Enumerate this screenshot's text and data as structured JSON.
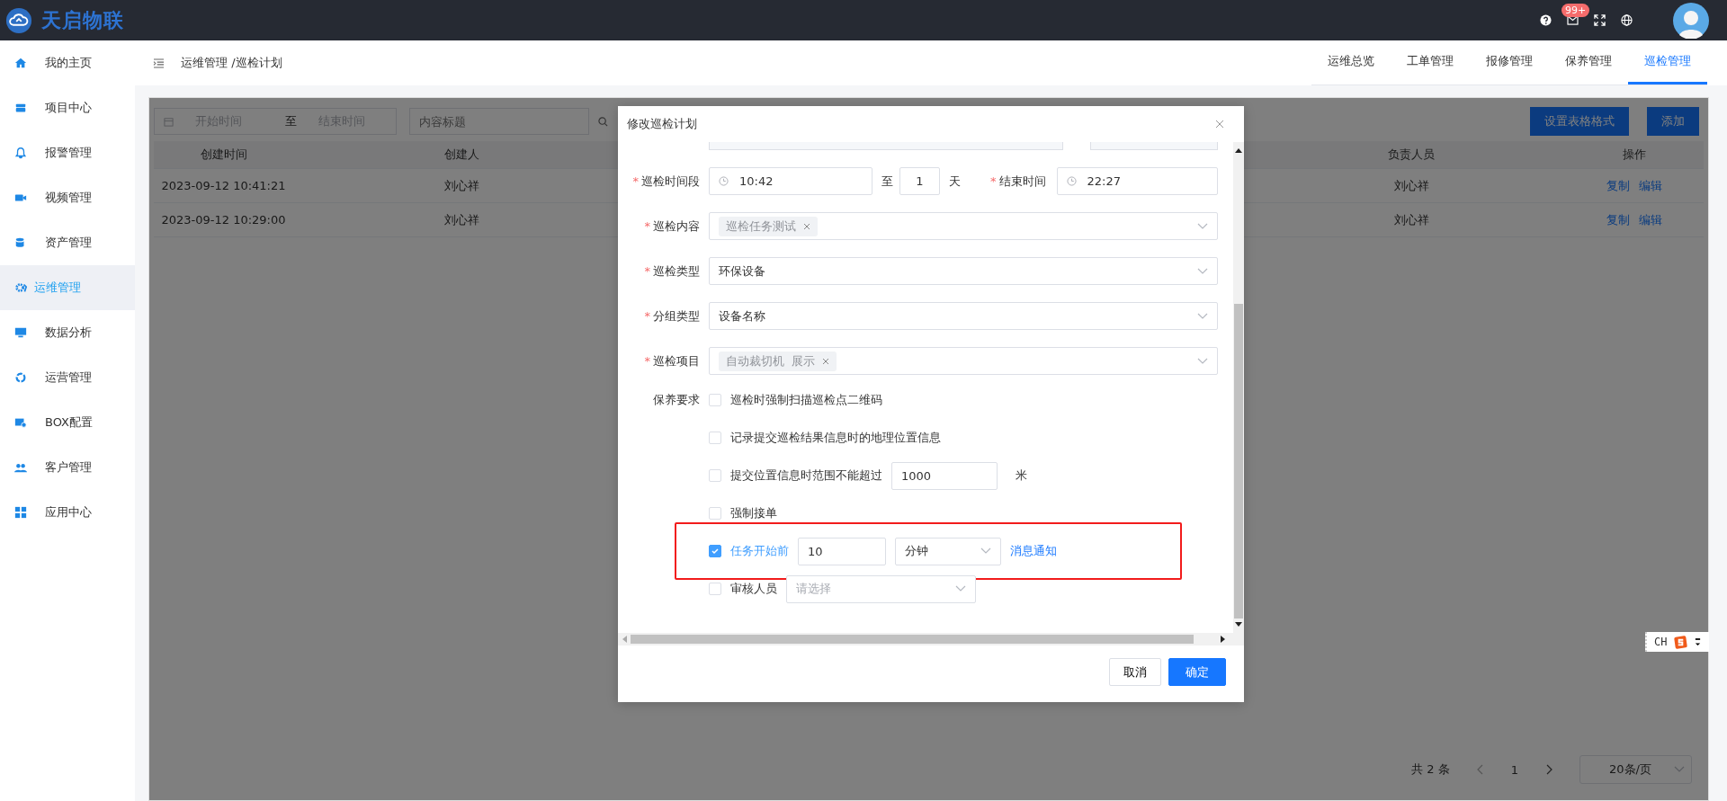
{
  "app": {
    "logo": "天启物联",
    "notification_count": "99+"
  },
  "sidebar": {
    "items": [
      {
        "label": "我的主页",
        "selected": false
      },
      {
        "label": "项目中心",
        "selected": false
      },
      {
        "label": "报警管理",
        "selected": false
      },
      {
        "label": "视频管理",
        "selected": false
      },
      {
        "label": "资产管理",
        "selected": false
      },
      {
        "label": "运维管理",
        "selected": true
      },
      {
        "label": "数据分析",
        "selected": false
      },
      {
        "label": "运营管理",
        "selected": false
      },
      {
        "label": "BOX配置",
        "selected": false
      },
      {
        "label": "客户管理",
        "selected": false
      },
      {
        "label": "应用中心",
        "selected": false
      }
    ]
  },
  "breadcrumb": "运维管理 /巡检计划",
  "tabs": [
    {
      "label": "运维总览",
      "selected": false
    },
    {
      "label": "工单管理",
      "selected": false
    },
    {
      "label": "报修管理",
      "selected": false
    },
    {
      "label": "保养管理",
      "selected": false
    },
    {
      "label": "巡检管理",
      "selected": true
    }
  ],
  "filters": {
    "start_placeholder": "开始时间",
    "range_separator": "至",
    "end_placeholder": "结束时间",
    "search_placeholder": "内容标题"
  },
  "toolbar_buttons": [
    "设置表格格式",
    "添加"
  ],
  "table": {
    "columns": [
      "创建时间",
      "创建人",
      "负责人员",
      "操作"
    ],
    "rows": [
      {
        "created": "2023-09-12 10:41:21",
        "creator": "刘心祥",
        "owner": "刘心祥",
        "actions": [
          "复制",
          "编辑"
        ]
      },
      {
        "created": "2023-09-12 10:29:00",
        "creator": "刘心祥",
        "owner": "刘心祥",
        "actions": [
          "复制",
          "编辑"
        ]
      }
    ]
  },
  "pagination": {
    "total": "共 2 条",
    "page": "1",
    "page_size": "20条/页"
  },
  "dialog": {
    "title": "修改巡检计划",
    "time_row": {
      "label": "巡检时间段",
      "required_mark": "*",
      "start": "10:42",
      "to": "至",
      "days": "1",
      "days_unit": "天",
      "end_label": "结束时间",
      "end_required_mark": "*",
      "end": "22:27"
    },
    "fields": [
      {
        "label": "巡检内容",
        "required_mark": "*",
        "kind": "tags",
        "tags": [
          "巡检任务测试"
        ]
      },
      {
        "label": "巡检类型",
        "required_mark": "*",
        "kind": "select",
        "value": "环保设备"
      },
      {
        "label": "分组类型",
        "required_mark": "*",
        "kind": "select",
        "value": "设备名称"
      },
      {
        "label": "巡检项目",
        "required_mark": "*",
        "kind": "tags",
        "tags": [
          "自动裁切机  展示"
        ]
      }
    ],
    "requirements": {
      "label": "保养要求",
      "options": [
        {
          "kind": "plain",
          "label": "巡检时强制扫描巡检点二维码",
          "checked": false
        },
        {
          "kind": "plain",
          "label": "记录提交巡检结果信息时的地理位置信息",
          "checked": false
        },
        {
          "kind": "distance",
          "label": "提交位置信息时范围不能超过",
          "value": "1000",
          "unit": "米",
          "checked": false
        },
        {
          "kind": "plain",
          "label": "强制接单",
          "checked": false
        },
        {
          "kind": "reminder",
          "label": "任务开始前",
          "value": "10",
          "unit": "分钟",
          "link": "消息通知",
          "checked": true,
          "highlighted": true
        },
        {
          "kind": "reviewer",
          "label": "审核人员",
          "placeholder": "请选择",
          "checked": false
        }
      ]
    },
    "buttons": [
      {
        "label": "取消",
        "primary": false
      },
      {
        "label": "确定",
        "primary": true
      }
    ]
  },
  "ime": {
    "label": "CH"
  }
}
